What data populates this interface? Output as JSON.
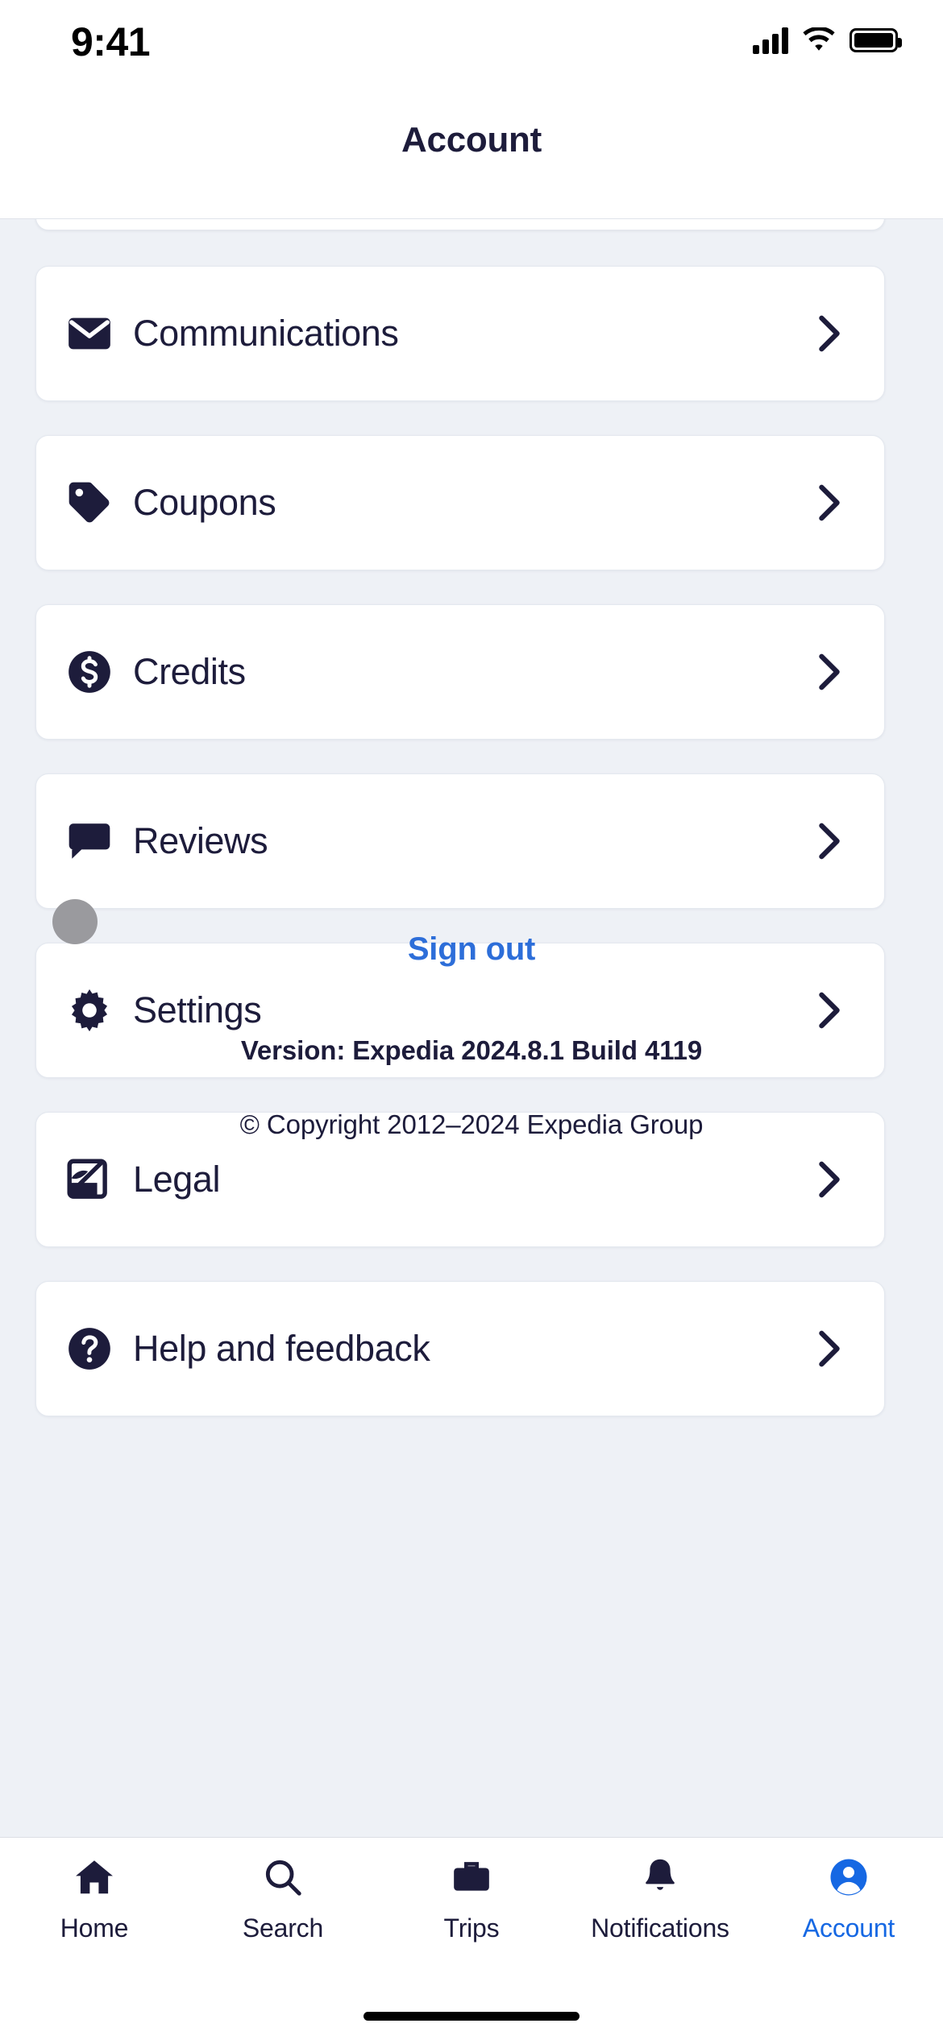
{
  "status_bar": {
    "time": "9:41",
    "icons": [
      "cellular-signal-icon",
      "wifi-icon",
      "battery-icon"
    ]
  },
  "header": {
    "title": "Account"
  },
  "colors": {
    "navy": "#1d1c3b",
    "accent_blue": "#1668e3",
    "link_blue": "#2d6ed9",
    "page_bg": "#eef1f6",
    "card_bg": "#ffffff"
  },
  "menu": {
    "items": [
      {
        "label": "Communications",
        "icon": "envelope-icon",
        "chevron": "chevron-right-icon"
      },
      {
        "label": "Coupons",
        "icon": "tag-icon",
        "chevron": "chevron-right-icon"
      },
      {
        "label": "Credits",
        "icon": "dollar-circle-icon",
        "chevron": "chevron-right-icon"
      },
      {
        "label": "Reviews",
        "icon": "speech-bubble-icon",
        "chevron": "chevron-right-icon"
      },
      {
        "label": "Settings",
        "icon": "gear-icon",
        "chevron": "chevron-right-icon"
      },
      {
        "label": "Legal",
        "icon": "document-quill-icon",
        "chevron": "chevron-right-icon"
      },
      {
        "label": "Help and feedback",
        "icon": "question-circle-icon",
        "chevron": "chevron-right-icon"
      }
    ]
  },
  "footer": {
    "sign_out_label": "Sign out",
    "version": "Version: Expedia 2024.8.1 Build 4119",
    "copyright": "© Copyright 2012–2024 Expedia Group"
  },
  "tab_bar": {
    "tabs": [
      {
        "label": "Home",
        "icon": "home-icon",
        "active": false
      },
      {
        "label": "Search",
        "icon": "search-icon",
        "active": false
      },
      {
        "label": "Trips",
        "icon": "briefcase-icon",
        "active": false
      },
      {
        "label": "Notifications",
        "icon": "bell-icon",
        "active": false
      },
      {
        "label": "Account",
        "icon": "person-circle-icon",
        "active": true
      }
    ]
  }
}
